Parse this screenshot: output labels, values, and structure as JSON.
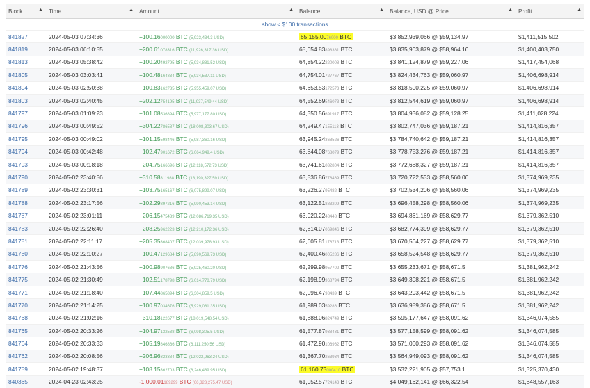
{
  "headers": [
    "Block",
    "Time",
    "Amount",
    "Balance",
    "Balance, USD @ Price",
    "Profit"
  ],
  "show_link": "show < $100 transactions",
  "rows": [
    {
      "block": "841827",
      "time": "2024-05-03 07:34:36",
      "amt": "+100.16",
      "amt_small": "000000",
      "amt_usd": "(5,923,434.3 USD)",
      "bal": "65,155.00",
      "bal_small": "76000",
      "usd_price": "$3,852,939,066 @ $59,134.97",
      "profit": "$1,411,515,502",
      "neg": false,
      "hl": true
    },
    {
      "block": "841819",
      "time": "2024-05-03 06:10:55",
      "amt": "+200.61",
      "amt_small": "078316",
      "amt_usd": "(11,926,317.36 USD)",
      "bal": "65,054.83",
      "bal_small": "898381",
      "usd_price": "$3,835,903,879 @ $58,964.16",
      "profit": "$1,400,403,750",
      "neg": false,
      "hl": false
    },
    {
      "block": "841813",
      "time": "2024-05-03 05:38:42",
      "amt": "+100.20",
      "amt_small": "492795",
      "amt_usd": "(5,934,881.52 USD)",
      "bal": "64,854.22",
      "bal_small": "220008",
      "usd_price": "$3,841,124,879 @ $59,227.06",
      "profit": "$1,417,454,068",
      "neg": false,
      "hl": false
    },
    {
      "block": "841805",
      "time": "2024-05-03 03:03:41",
      "amt": "+100.48",
      "amt_small": "164834",
      "amt_usd": "(5,934,537.11 USD)",
      "bal": "64,754.01",
      "bal_small": "727767",
      "usd_price": "$3,824,434,763 @ $59,060.97",
      "profit": "$1,406,698,914",
      "neg": false,
      "hl": false
    },
    {
      "block": "841804",
      "time": "2024-05-03 02:50:38",
      "amt": "+100.83",
      "amt_small": "162735",
      "amt_usd": "(5,955,459.07 USD)",
      "bal": "64,653.53",
      "bal_small": "172573",
      "usd_price": "$3,818,500,225 @ $59,060.97",
      "profit": "$1,406,698,914",
      "neg": false,
      "hl": false
    },
    {
      "block": "841803",
      "time": "2024-05-03 02:40:45",
      "amt": "+202.12",
      "amt_small": "754195",
      "amt_usd": "(11,937,549.44 USD)",
      "bal": "64,552.69",
      "bal_small": "546073",
      "usd_price": "$3,812,544,619 @ $59,060.97",
      "profit": "$1,406,698,914",
      "neg": false,
      "hl": false
    },
    {
      "block": "841797",
      "time": "2024-05-03 01:09:23",
      "amt": "+101.08",
      "amt_small": "536894",
      "amt_usd": "(5,977,177.80 USD)",
      "bal": "64,350.56",
      "bal_small": "691917",
      "usd_price": "$3,804,936,082 @ $59,128.25",
      "profit": "$1,411,028,224",
      "neg": false,
      "hl": false
    },
    {
      "block": "841796",
      "time": "2024-05-03 00:49:52",
      "amt": "+304.22",
      "amt_small": "786587",
      "amt_usd": "(18,008,303.67 USD)",
      "bal": "64,249.47",
      "bal_small": "155113",
      "usd_price": "$3,802,747,036 @ $59,187.21",
      "profit": "$1,414,816,357",
      "neg": false,
      "hl": false
    },
    {
      "block": "841795",
      "time": "2024-05-03 00:49:02",
      "amt": "+101.15",
      "amt_small": "598446",
      "amt_usd": "(5,987,360.16 USD)",
      "bal": "63,945.24",
      "bal_small": "368526",
      "usd_price": "$3,784,740,642 @ $59,187.21",
      "profit": "$1,414,816,357",
      "neg": false,
      "hl": false
    },
    {
      "block": "841794",
      "time": "2024-05-03 00:42:48",
      "amt": "+102.47",
      "amt_small": "901672",
      "amt_usd": "(6,064,949.4 USD)",
      "bal": "63,844.08",
      "bal_small": "768079",
      "usd_price": "$3,778,753,276 @ $59,187.21",
      "profit": "$1,414,816,357",
      "neg": false,
      "hl": false
    },
    {
      "block": "841793",
      "time": "2024-05-03 00:18:18",
      "amt": "+204.75",
      "amt_small": "166696",
      "amt_usd": "(12,118,572.73 USD)",
      "bal": "63,741.61",
      "bal_small": "032804",
      "usd_price": "$3,772,688,327 @ $59,187.21",
      "profit": "$1,414,816,357",
      "neg": false,
      "hl": false
    },
    {
      "block": "841790",
      "time": "2024-05-02 23:40:56",
      "amt": "+310.58",
      "amt_small": "311988",
      "amt_usd": "(18,190,327.59 USD)",
      "bal": "63,536.86",
      "bal_small": "776469",
      "usd_price": "$3,720,722,533 @ $58,560.06",
      "profit": "$1,374,969,235",
      "neg": false,
      "hl": false
    },
    {
      "block": "841789",
      "time": "2024-05-02 23:30:31",
      "amt": "+103.75",
      "amt_small": "165167",
      "amt_usd": "(6,075,899.07 USD)",
      "bal": "63,226.27",
      "bal_small": "95482",
      "usd_price": "$3,702,534,206 @ $58,560.06",
      "profit": "$1,374,969,235",
      "neg": false,
      "hl": false
    },
    {
      "block": "841788",
      "time": "2024-05-02 23:17:56",
      "amt": "+102.29",
      "amt_small": "897216",
      "amt_usd": "(5,990,453.14 USD)",
      "bal": "63,122.51",
      "bal_small": "883209",
      "usd_price": "$3,696,458,298 @ $58,560.06",
      "profit": "$1,374,969,235",
      "neg": false,
      "hl": false
    },
    {
      "block": "841787",
      "time": "2024-05-02 23:01:11",
      "amt": "+206.15",
      "amt_small": "475439",
      "amt_usd": "(12,086,719.35 USD)",
      "bal": "63,020.22",
      "bal_small": "48448",
      "usd_price": "$3,694,861,169 @ $58,629.77",
      "profit": "$1,379,362,510",
      "neg": false,
      "hl": false
    },
    {
      "block": "841783",
      "time": "2024-05-02 22:26:40",
      "amt": "+208.25",
      "amt_small": "962223",
      "amt_usd": "(12,210,172.36 USD)",
      "bal": "62,814.07",
      "bal_small": "069846",
      "usd_price": "$3,682,774,399 @ $58,629.77",
      "profit": "$1,379,362,510",
      "neg": false,
      "hl": false
    },
    {
      "block": "841781",
      "time": "2024-05-02 22:11:17",
      "amt": "+205.35",
      "amt_small": "368407",
      "amt_usd": "(12,039,978.93 USD)",
      "bal": "62,605.81",
      "bal_small": "176713",
      "usd_price": "$3,670,564,227 @ $58,629.77",
      "profit": "$1,379,362,510",
      "neg": false,
      "hl": false
    },
    {
      "block": "841780",
      "time": "2024-05-02 22:10:27",
      "amt": "+100.47",
      "amt_small": "129684",
      "amt_usd": "(5,890,569.73 USD)",
      "bal": "62,400.46",
      "bal_small": "005286",
      "usd_price": "$3,658,524,548 @ $58,629.77",
      "profit": "$1,379,362,510",
      "neg": false,
      "hl": false
    },
    {
      "block": "841776",
      "time": "2024-05-02 21:43:56",
      "amt": "+100.98",
      "amt_small": "907686",
      "amt_usd": "(5,925,460.20 USD)",
      "bal": "62,299.98",
      "bal_small": "957702",
      "usd_price": "$3,655,233,671 @ $58,671.5",
      "profit": "$1,381,962,242",
      "neg": false,
      "hl": false
    },
    {
      "block": "841775",
      "time": "2024-05-02 21:30:49",
      "amt": "+102.51",
      "amt_small": "178798",
      "amt_usd": "(6,014,778.79 USD)",
      "bal": "62,198.99",
      "bal_small": "968794",
      "usd_price": "$3,649,308,221 @ $58,671.5",
      "profit": "$1,381,962,242",
      "neg": false,
      "hl": false
    },
    {
      "block": "841771",
      "time": "2024-05-02 21:18:40",
      "amt": "+107.44",
      "amt_small": "865894",
      "amt_usd": "(6,304,859.5 USD)",
      "bal": "62,096.47",
      "bal_small": "98439",
      "usd_price": "$3,643,293,442 @ $58,671.5",
      "profit": "$1,381,962,242",
      "neg": false,
      "hl": false
    },
    {
      "block": "841770",
      "time": "2024-05-02 21:14:25",
      "amt": "+100.97",
      "amt_small": "034676",
      "amt_usd": "(5,929,081.35 USD)",
      "bal": "61,989.03",
      "bal_small": "59286",
      "usd_price": "$3,636,989,386 @ $58,671.5",
      "profit": "$1,381,962,242",
      "neg": false,
      "hl": false
    },
    {
      "block": "841768",
      "time": "2024-05-02 21:02:16",
      "amt": "+310.18",
      "amt_small": "122677",
      "amt_usd": "(18,019,548.54 USD)",
      "bal": "61,888.06",
      "bal_small": "824749",
      "usd_price": "$3,595,177,647 @ $58,091.62",
      "profit": "$1,346,074,585",
      "neg": false,
      "hl": false
    },
    {
      "block": "841765",
      "time": "2024-05-02 20:33:26",
      "amt": "+104.97",
      "amt_small": "132538",
      "amt_usd": "(6,098,305.5 USD)",
      "bal": "61,577.87",
      "bal_small": "938431",
      "usd_price": "$3,577,158,599 @ $58,091.62",
      "profit": "$1,346,074,585",
      "neg": false,
      "hl": false
    },
    {
      "block": "841764",
      "time": "2024-05-02 20:33:33",
      "amt": "+105.19",
      "amt_small": "846866",
      "amt_usd": "(6,111,250.56 USD)",
      "bal": "61,472.90",
      "bal_small": "106962",
      "usd_price": "$3,571,060,293 @ $58,091.62",
      "profit": "$1,346,074,585",
      "neg": false,
      "hl": false
    },
    {
      "block": "841762",
      "time": "2024-05-02 20:08:56",
      "amt": "+206.96",
      "amt_small": "323384",
      "amt_usd": "(12,022,963.24 USD)",
      "bal": "61,367.70",
      "bal_small": "263934",
      "usd_price": "$3,564,949,093 @ $58,091.62",
      "profit": "$1,346,074,585",
      "neg": false,
      "hl": false
    },
    {
      "block": "841759",
      "time": "2024-05-02 19:48:37",
      "amt": "+108.15",
      "amt_small": "362703",
      "amt_usd": "(6,246,489.95 USD)",
      "bal": "61,160.73",
      "bal_small": "000410",
      "usd_price": "$3,532,221,905 @ $57,753.1",
      "profit": "$1,325,370,430",
      "neg": false,
      "hl": true
    },
    {
      "block": "840365",
      "time": "2024-04-23 02:43:25",
      "amt": "-1,000.01",
      "amt_small": "189299",
      "amt_usd": "(66,323,275.47 USD)",
      "bal": "61,052.57",
      "bal_small": "724143",
      "usd_price": "$4,049,162,141 @ $66,322.54",
      "profit": "$1,848,557,163",
      "neg": true,
      "hl": false
    }
  ]
}
